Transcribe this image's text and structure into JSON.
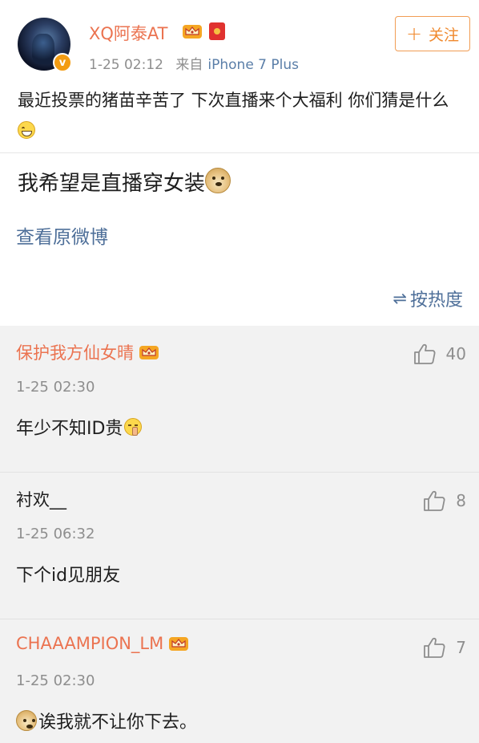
{
  "post": {
    "author": "XQ阿泰AT",
    "time": "1-25 02:12",
    "source_prefix": "来自",
    "device": "iPhone 7 Plus",
    "follow_label": "关注",
    "text": "最近投票的猪苗辛苦了 下次直播来个大福利 你们猜是什么",
    "verified_badge": "v"
  },
  "repost": {
    "text": "我希望是直播穿女装",
    "view_original": "查看原微博"
  },
  "sort": {
    "label": "按热度"
  },
  "comments": [
    {
      "name": "保护我方仙女晴",
      "time": "1-25 02:30",
      "text": "年少不知ID贵",
      "likes": "40",
      "vip": true
    },
    {
      "name": "衬欢__",
      "time": "1-25 06:32",
      "text": "下个id见朋友",
      "likes": "8",
      "vip": false
    },
    {
      "name": "CHAAAMPION_LM",
      "time": "1-25 02:30",
      "text": "诶我就不让你下去。",
      "likes": "7",
      "vip": true
    }
  ],
  "colors": {
    "username_orange": "#eb7350",
    "link_blue": "#4e6f99",
    "follow_orange": "#f0892d",
    "comments_bg": "#f2f2f2"
  },
  "icons": {
    "vip": "crown-icon",
    "redpacket": "red-packet-icon",
    "like": "thumbs-up-icon",
    "sort": "sort-icon",
    "follow": "plus-icon"
  }
}
